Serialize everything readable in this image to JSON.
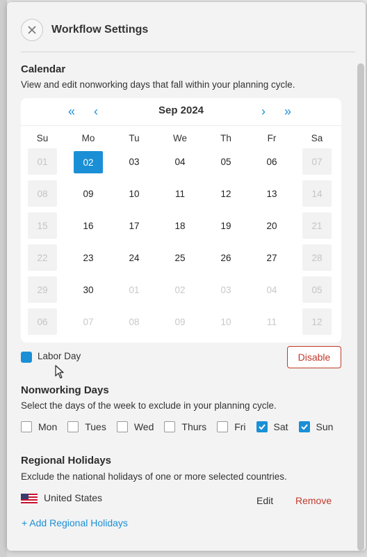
{
  "header": {
    "title": "Workflow Settings",
    "close_icon": "close-icon"
  },
  "calendar_section": {
    "title": "Calendar",
    "description": "View and edit nonworking days that fall within your planning cycle."
  },
  "calendar": {
    "month_label": "Sep 2024",
    "nav": {
      "prev_year": "«",
      "prev_month": "‹",
      "next_month": "›",
      "next_year": "»"
    },
    "weekdays": [
      "Su",
      "Mo",
      "Tu",
      "We",
      "Th",
      "Fr",
      "Sa"
    ],
    "weeks": [
      [
        "01",
        "02",
        "03",
        "04",
        "05",
        "06",
        "07"
      ],
      [
        "08",
        "09",
        "10",
        "11",
        "12",
        "13",
        "14"
      ],
      [
        "15",
        "16",
        "17",
        "18",
        "19",
        "20",
        "21"
      ],
      [
        "22",
        "23",
        "24",
        "25",
        "26",
        "27",
        "28"
      ],
      [
        "29",
        "30",
        "01",
        "02",
        "03",
        "04",
        "05"
      ],
      [
        "06",
        "07",
        "08",
        "09",
        "10",
        "11",
        "12"
      ]
    ],
    "selected_day": "02",
    "selected_color": "#1a8fd6"
  },
  "legend": {
    "label": "Labor Day",
    "color": "#1a8fd6",
    "disable_label": "Disable"
  },
  "nonworking": {
    "title": "Nonworking Days",
    "description": "Select the days of the week to exclude in your planning cycle.",
    "days": [
      {
        "label": "Mon",
        "checked": false
      },
      {
        "label": "Tues",
        "checked": false
      },
      {
        "label": "Wed",
        "checked": false
      },
      {
        "label": "Thurs",
        "checked": false
      },
      {
        "label": "Fri",
        "checked": false
      },
      {
        "label": "Sat",
        "checked": true
      },
      {
        "label": "Sun",
        "checked": true
      }
    ]
  },
  "regional": {
    "title": "Regional Holidays",
    "description": "Exclude the national holidays of one or more selected countries.",
    "countries": [
      {
        "name": "United States",
        "flag_icon": "us-flag-icon",
        "edit_label": "Edit",
        "remove_label": "Remove"
      }
    ],
    "add_label": "+ Add Regional Holidays"
  }
}
